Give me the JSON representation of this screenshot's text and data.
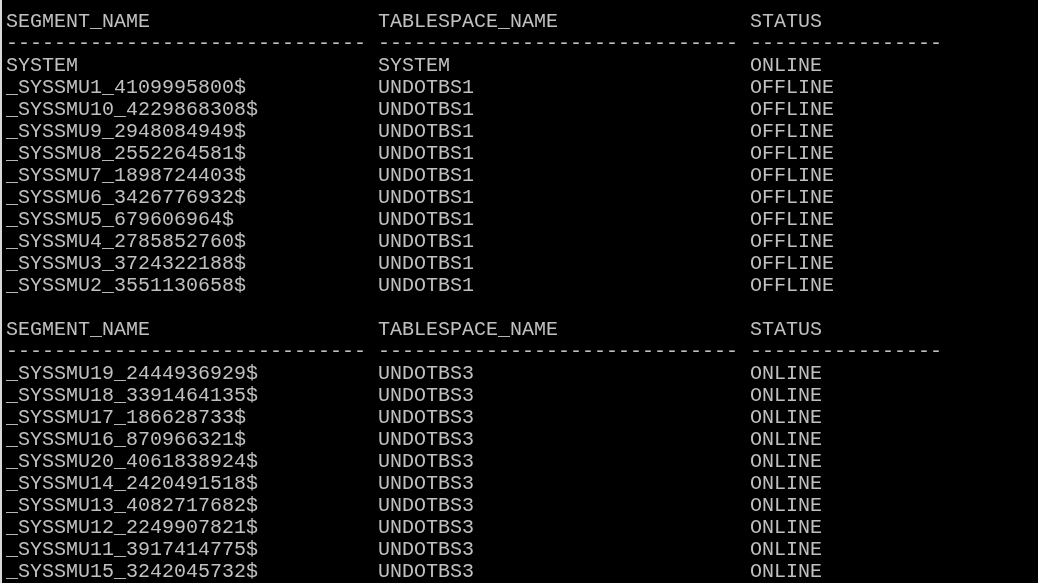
{
  "blocks": [
    {
      "columns": [
        "SEGMENT_NAME",
        "TABLESPACE_NAME",
        "STATUS"
      ],
      "rules": [
        "------------------------------",
        "------------------------------",
        "----------------"
      ],
      "rows": [
        {
          "segment_name": "SYSTEM",
          "tablespace_name": "SYSTEM",
          "status": "ONLINE"
        },
        {
          "segment_name": "_SYSSMU1_4109995800$",
          "tablespace_name": "UNDOTBS1",
          "status": "OFFLINE"
        },
        {
          "segment_name": "_SYSSMU10_4229868308$",
          "tablespace_name": "UNDOTBS1",
          "status": "OFFLINE"
        },
        {
          "segment_name": "_SYSSMU9_2948084949$",
          "tablespace_name": "UNDOTBS1",
          "status": "OFFLINE"
        },
        {
          "segment_name": "_SYSSMU8_2552264581$",
          "tablespace_name": "UNDOTBS1",
          "status": "OFFLINE"
        },
        {
          "segment_name": "_SYSSMU7_1898724403$",
          "tablespace_name": "UNDOTBS1",
          "status": "OFFLINE"
        },
        {
          "segment_name": "_SYSSMU6_3426776932$",
          "tablespace_name": "UNDOTBS1",
          "status": "OFFLINE"
        },
        {
          "segment_name": "_SYSSMU5_679606964$",
          "tablespace_name": "UNDOTBS1",
          "status": "OFFLINE"
        },
        {
          "segment_name": "_SYSSMU4_2785852760$",
          "tablespace_name": "UNDOTBS1",
          "status": "OFFLINE"
        },
        {
          "segment_name": "_SYSSMU3_3724322188$",
          "tablespace_name": "UNDOTBS1",
          "status": "OFFLINE"
        },
        {
          "segment_name": "_SYSSMU2_3551130658$",
          "tablespace_name": "UNDOTBS1",
          "status": "OFFLINE"
        }
      ]
    },
    {
      "columns": [
        "SEGMENT_NAME",
        "TABLESPACE_NAME",
        "STATUS"
      ],
      "rules": [
        "------------------------------",
        "------------------------------",
        "----------------"
      ],
      "rows": [
        {
          "segment_name": "_SYSSMU19_2444936929$",
          "tablespace_name": "UNDOTBS3",
          "status": "ONLINE"
        },
        {
          "segment_name": "_SYSSMU18_3391464135$",
          "tablespace_name": "UNDOTBS3",
          "status": "ONLINE"
        },
        {
          "segment_name": "_SYSSMU17_186628733$",
          "tablespace_name": "UNDOTBS3",
          "status": "ONLINE"
        },
        {
          "segment_name": "_SYSSMU16_870966321$",
          "tablespace_name": "UNDOTBS3",
          "status": "ONLINE"
        },
        {
          "segment_name": "_SYSSMU20_4061838924$",
          "tablespace_name": "UNDOTBS3",
          "status": "ONLINE"
        },
        {
          "segment_name": "_SYSSMU14_2420491518$",
          "tablespace_name": "UNDOTBS3",
          "status": "ONLINE"
        },
        {
          "segment_name": "_SYSSMU13_4082717682$",
          "tablespace_name": "UNDOTBS3",
          "status": "ONLINE"
        },
        {
          "segment_name": "_SYSSMU12_2249907821$",
          "tablespace_name": "UNDOTBS3",
          "status": "ONLINE"
        },
        {
          "segment_name": "_SYSSMU11_3917414775$",
          "tablespace_name": "UNDOTBS3",
          "status": "ONLINE"
        },
        {
          "segment_name": "_SYSSMU15_3242045732$",
          "tablespace_name": "UNDOTBS3",
          "status": "ONLINE"
        }
      ]
    }
  ]
}
